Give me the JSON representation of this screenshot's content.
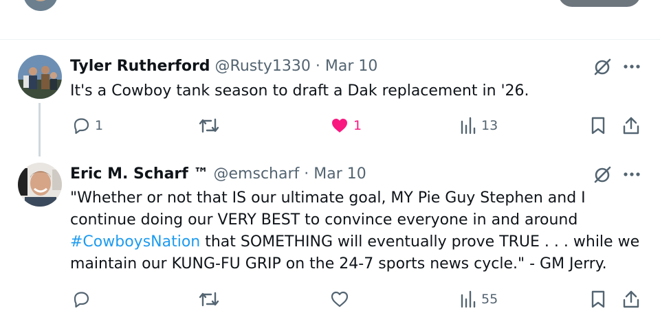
{
  "tweets": [
    {
      "name": "Tyler Rutherford",
      "handle": "@Rusty1330",
      "separator": "·",
      "date": "Mar 10",
      "text": "It's a Cowboy tank season to draft a Dak replacement in '26.",
      "replies": "1",
      "reposts": "",
      "likes": "1",
      "views": "13",
      "liked": true
    },
    {
      "name": "Eric M. Scharf ™",
      "handle": "@emscharf",
      "separator": "·",
      "date": "Mar 10",
      "text_before": "\"Whether or not that IS our ultimate goal, MY Pie Guy Stephen and I continue doing our VERY BEST to convince everyone in and around ",
      "hashtag": "#CowboysNation",
      "text_after": " that SOMETHING will eventually prove TRUE . . . while we maintain our KUNG-FU GRIP on the 24-7 sports news cycle.\" - GM Jerry.",
      "replies": "",
      "reposts": "",
      "likes": "",
      "views": "55",
      "liked": false
    }
  ],
  "icons": {
    "reply": "reply-icon",
    "repost": "repost-icon",
    "like": "heart-icon",
    "views": "views-icon",
    "bookmark": "bookmark-icon",
    "share": "share-icon",
    "grok": "grok-icon",
    "more": "more-icon"
  },
  "colors": {
    "like_active": "#f91880",
    "hashtag": "#1d9bf0",
    "secondary_text": "#536471"
  }
}
